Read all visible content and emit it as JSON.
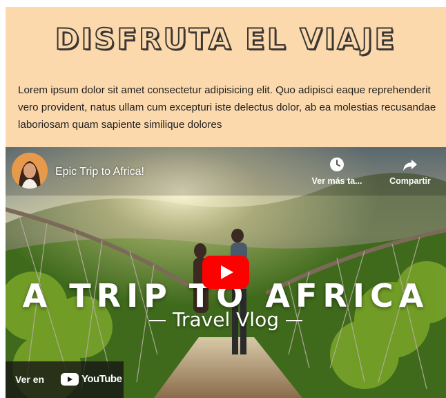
{
  "card": {
    "heading": "DISFRUTA EL VIAJE",
    "paragraph": "Lorem ipsum dolor sit amet consectetur adipisicing elit. Quo adipisci eaque reprehenderit vero provident, natus ullam cum excepturi iste delectus dolor, ab ea molestias recusandae laboriosam quam sapiente similique dolores",
    "background": "#fcd9ad"
  },
  "video": {
    "title": "Epic Trip to Africa!",
    "watch_later_label": "Ver más ta...",
    "share_label": "Compartir",
    "overlay_title": "A TRIP TO AFRICA",
    "overlay_subtitle": "Travel Vlog",
    "watch_on_label": "Ver en",
    "youtube_wordmark": "YouTube",
    "play_button_color": "#ff0000",
    "icons": [
      "clock-icon",
      "share-icon",
      "play-icon",
      "youtube-logo-icon"
    ]
  }
}
